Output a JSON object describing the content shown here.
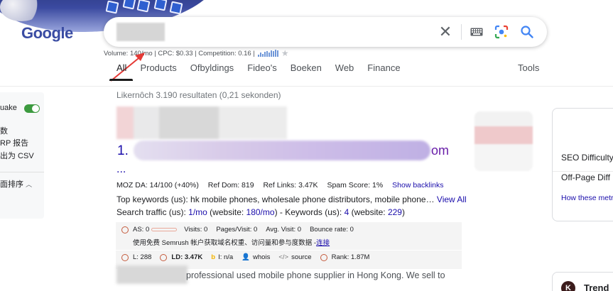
{
  "logo": {
    "text": "Google"
  },
  "search": {
    "keyword_stats": "Volume: 140/mo | CPC: $0.33 | Competition: 0.16 |",
    "trend_bars": [
      3,
      5,
      4,
      6,
      7,
      5,
      8,
      7,
      9,
      8
    ]
  },
  "tabs": [
    "All",
    "Products",
    "Ofbyldings",
    "Fideo's",
    "Boeken",
    "Web",
    "Finance"
  ],
  "tools_label": "Tools",
  "left_panel": {
    "toggle_label": "uake",
    "line1": "数",
    "line2": "RP 报告",
    "line3": "出为 CSV",
    "sort_label": "面排序"
  },
  "results": {
    "stats": "Likernôch 3.190 resultaten (0,21 sekonden)",
    "result": {
      "number": "1.",
      "title_tail": "om",
      "ellipsis": "...",
      "moz": {
        "da": "MOZ DA: 14/100 (+40%)",
        "ref_dom": "Ref Dom: 819",
        "ref_links": "Ref Links: 3.47K",
        "spam": "Spam Score: 1%",
        "backlinks_link": "Show backlinks"
      },
      "top_keywords_text": "Top keywords (us): hk mobile phones, wholesale phone distributors, mobile phone…",
      "view_all": "View All",
      "traffic": {
        "prefix": "Search traffic (us): ",
        "value1": "1/mo",
        "mid1": " (website: ",
        "value2": "180/mo",
        "mid2": ") - Keywords (us): ",
        "value3": "4",
        "mid3": " (website: ",
        "value4": "229",
        "suffix": ")"
      },
      "semrush": {
        "as_label": "AS: 0",
        "visits": "Visits: 0",
        "pages_visit": "Pages/Visit: 0",
        "avg_visit": "Avg. Visit: 0",
        "bounce": "Bounce rate: 0",
        "cta_text": "使用免费 Semrush 帐户获取域名权重、访问量和参与度数据 - ",
        "cta_link": "连接",
        "l_label": "L: 288",
        "ld_label": "LD: 3.47K",
        "i_label": "I: n/a",
        "whois": "whois",
        "source": "source",
        "rank": "Rank: 1.87M"
      },
      "snippet": "professional used mobile phone supplier in Hong Kong. We sell to"
    }
  },
  "right_panel": {
    "seo_difficulty": "SEO Difficulty",
    "offpage": "Off-Page Diff",
    "how_metrics": "How these metr",
    "trend_icon": "K",
    "trend_label": "Trend"
  }
}
